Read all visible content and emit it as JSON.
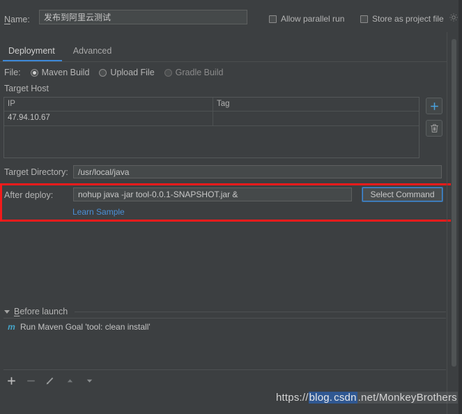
{
  "header": {
    "name_label": "Name:",
    "name_value": "发布到阿里云测试",
    "allow_parallel_run": "Allow parallel run",
    "store_as_project_file": "Store as project file",
    "gear_icon": "gear-icon"
  },
  "tabs": [
    {
      "label": "Deployment",
      "active": true
    },
    {
      "label": "Advanced",
      "active": false
    }
  ],
  "file_row": {
    "label": "File:",
    "options": [
      {
        "label": "Maven Build",
        "selected": true,
        "disabled": false
      },
      {
        "label": "Upload File",
        "selected": false,
        "disabled": false
      },
      {
        "label": "Gradle Build",
        "selected": false,
        "disabled": true
      }
    ]
  },
  "target_host": {
    "title": "Target Host",
    "columns": [
      "IP",
      "Tag"
    ],
    "rows": [
      {
        "ip": "47.94.10.67",
        "tag": ""
      }
    ],
    "add_button": "add-icon",
    "delete_button": "trash-icon"
  },
  "target_directory": {
    "label": "Target Directory:",
    "value": "/usr/local/java"
  },
  "after_deploy": {
    "label": "After deploy:",
    "value": "nohup java -jar tool-0.0.1-SNAPSHOT.jar &",
    "select_command_button": "Select Command",
    "learn_sample_link": "Learn Sample",
    "highlight_color": "#f11b1b"
  },
  "before_launch": {
    "title": "Before launch",
    "items": [
      {
        "icon": "maven-icon",
        "icon_glyph": "m",
        "label": "Run Maven Goal 'tool: clean install'"
      }
    ],
    "toolbar": [
      {
        "name": "add-icon",
        "glyph": "+"
      },
      {
        "name": "remove-icon",
        "glyph": "−"
      },
      {
        "name": "edit-pencil-icon",
        "glyph": "✎"
      },
      {
        "name": "move-up-icon",
        "glyph": "▲"
      },
      {
        "name": "move-down-icon",
        "glyph": "▼"
      }
    ]
  },
  "watermark": {
    "prefix": "https://",
    "highlight": "blog.",
    "middle": "csdn",
    "suffix": ".net/MonkeyBrothers"
  },
  "colors": {
    "background": "#3c3f41",
    "field_background": "#45494a",
    "accent_blue": "#3d88d8",
    "link_blue": "#4a8fd6",
    "highlight_red": "#f11b1b",
    "maven_icon": "#45a5c9"
  }
}
